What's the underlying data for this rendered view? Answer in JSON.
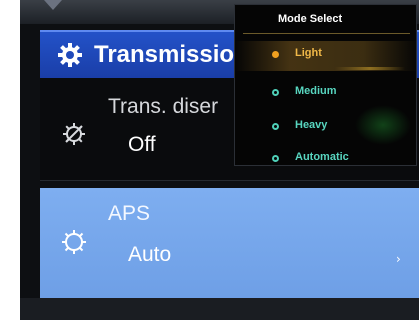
{
  "header": {
    "title": "Transmission",
    "icon": "gear-icon"
  },
  "settings": [
    {
      "label": "Trans. diser",
      "value": "Off",
      "icon": "gear-off-icon"
    },
    {
      "label": "APS",
      "value": "Auto",
      "icon": "gear-outline-icon",
      "chevron": "›"
    }
  ],
  "popup": {
    "title": "Mode Select",
    "options": [
      {
        "label": "Light",
        "selected": true
      },
      {
        "label": "Medium",
        "selected": false
      },
      {
        "label": "Heavy",
        "selected": false
      },
      {
        "label": "Automatic",
        "selected": false
      }
    ]
  },
  "colors": {
    "header_blue": "#2352c8",
    "selected_row_blue": "#7eaef0",
    "popup_selected_amber": "#f0a020",
    "popup_option_teal": "#4fd0b8"
  }
}
